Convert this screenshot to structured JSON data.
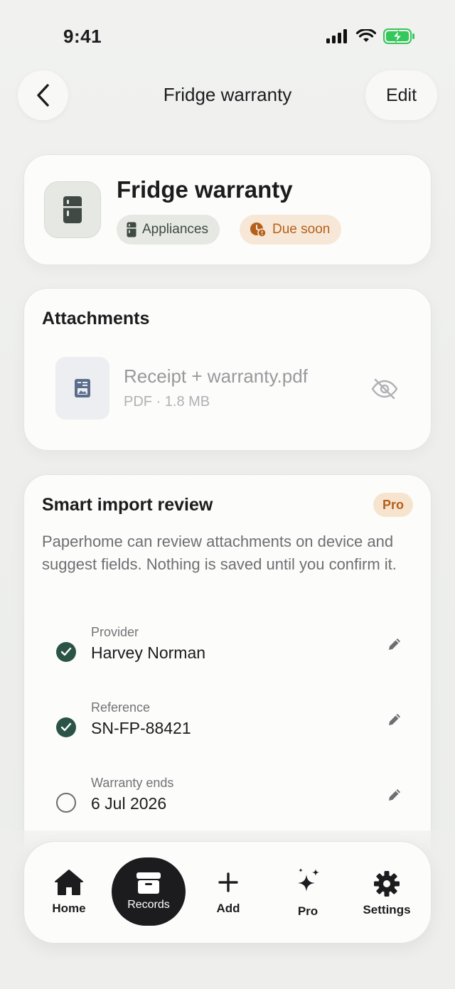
{
  "status_bar": {
    "time": "9:41"
  },
  "nav": {
    "title": "Fridge warranty",
    "edit_label": "Edit"
  },
  "record": {
    "title": "Fridge warranty",
    "category": "Appliances",
    "status": "Due soon",
    "icon": "fridge-icon"
  },
  "attachments": {
    "title": "Attachments",
    "file": {
      "name": "Receipt + warranty.pdf",
      "meta": "PDF · 1.8 MB"
    }
  },
  "review": {
    "title": "Smart import review",
    "badge": "Pro",
    "description": "Paperhome can review attachments on device and suggest fields. Nothing is saved until you confirm it.",
    "fields": [
      {
        "label": "Provider",
        "value": "Harvey Norman",
        "confirmed": true
      },
      {
        "label": "Reference",
        "value": "SN-FP-88421",
        "confirmed": true
      },
      {
        "label": "Warranty ends",
        "value": "6 Jul 2026",
        "confirmed": false
      }
    ]
  },
  "tabbar": {
    "items": [
      {
        "label": "Home",
        "icon": "home-icon"
      },
      {
        "label": "Records",
        "icon": "archive-box-icon",
        "active": true
      },
      {
        "label": "Add",
        "icon": "plus-icon"
      },
      {
        "label": "Pro",
        "icon": "sparkles-icon"
      },
      {
        "label": "Settings",
        "icon": "gear-icon"
      }
    ]
  },
  "colors": {
    "accent_green": "#2b5447",
    "due_orange": "#b5601a",
    "battery_green": "#34c759"
  }
}
